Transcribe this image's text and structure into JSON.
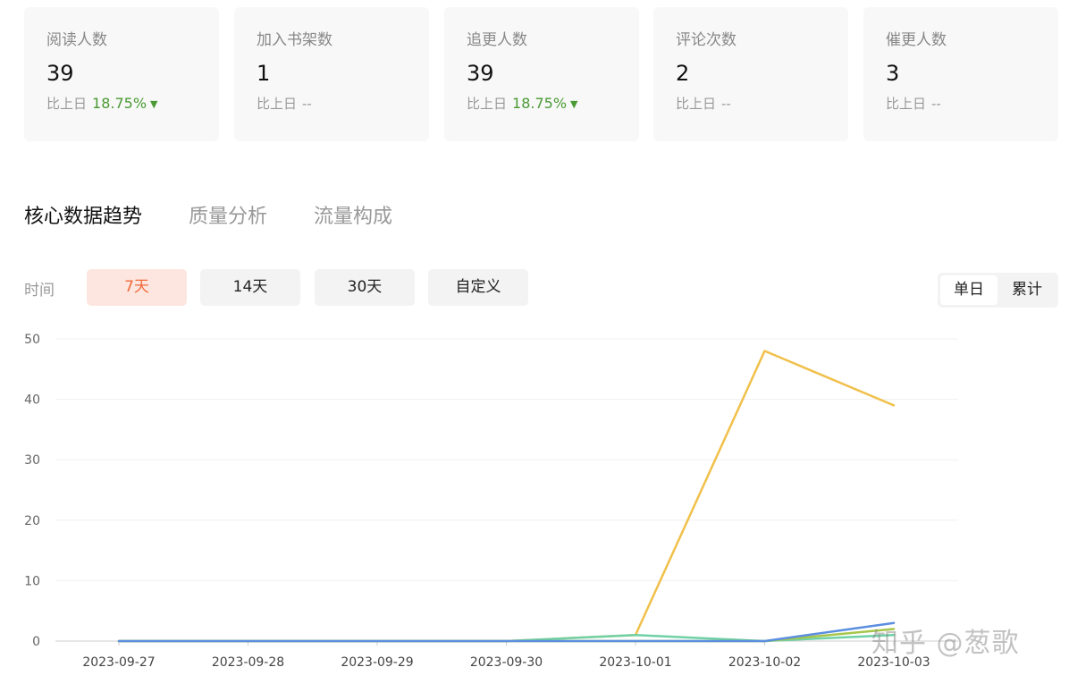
{
  "stats": [
    {
      "label": "阅读人数",
      "value": "39",
      "compare_label": "比上日",
      "change": "18.75%",
      "trend": "down"
    },
    {
      "label": "加入书架数",
      "value": "1",
      "compare_label": "比上日",
      "change": "--",
      "trend": "none"
    },
    {
      "label": "追更人数",
      "value": "39",
      "compare_label": "比上日",
      "change": "18.75%",
      "trend": "down"
    },
    {
      "label": "评论次数",
      "value": "2",
      "compare_label": "比上日",
      "change": "--",
      "trend": "none"
    },
    {
      "label": "催更人数",
      "value": "3",
      "compare_label": "比上日",
      "change": "--",
      "trend": "none"
    }
  ],
  "tabs": [
    "核心数据趋势",
    "质量分析",
    "流量构成"
  ],
  "active_tab": 0,
  "time_label": "时间",
  "ranges": [
    "7天",
    "14天",
    "30天",
    "自定义"
  ],
  "active_range": 0,
  "mode_toggle": {
    "options": [
      "单日",
      "累计"
    ],
    "active": 0
  },
  "watermark": "知乎 @葱歌",
  "colors": {
    "accent": "#f06a3c",
    "down": "#4a9a33"
  },
  "chart_data": {
    "type": "line",
    "categories": [
      "2023-09-27",
      "2023-09-28",
      "2023-09-29",
      "2023-09-30",
      "2023-10-01",
      "2023-10-02",
      "2023-10-03"
    ],
    "ylim": [
      0,
      50
    ],
    "yticks": [
      0,
      10,
      20,
      30,
      40,
      50
    ],
    "grid": true,
    "series": [
      {
        "color": "#f0c04a",
        "values": [
          0,
          0,
          0,
          0,
          1,
          48,
          39
        ]
      },
      {
        "color": "#6fd1a5",
        "values": [
          0,
          0,
          0,
          0,
          1,
          0,
          1
        ]
      },
      {
        "color": "#a6c64a",
        "values": [
          0,
          0,
          0,
          0,
          0,
          0,
          2
        ]
      },
      {
        "color": "#5b8ee0",
        "values": [
          0,
          0,
          0,
          0,
          0,
          0,
          3
        ]
      }
    ]
  }
}
